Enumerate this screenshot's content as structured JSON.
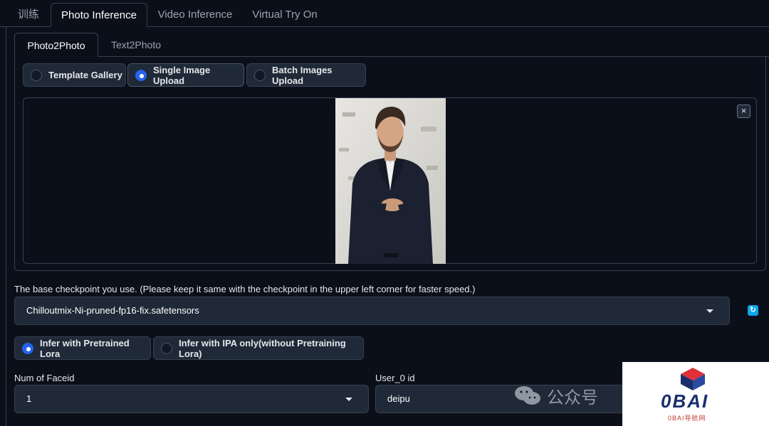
{
  "top_tabs": [
    "训练",
    "Photo Inference",
    "Video Inference",
    "Virtual Try On"
  ],
  "inner_tabs": [
    "Photo2Photo",
    "Text2Photo"
  ],
  "upload_mode": {
    "options": [
      "Template Gallery",
      "Single Image Upload",
      "Batch Images Upload"
    ],
    "selected": "Single Image Upload"
  },
  "image_panel": {
    "close_glyph": "×"
  },
  "checkpoint": {
    "label": "The base checkpoint you use. (Please keep it same with the checkpoint in the upper left corner for faster speed.)",
    "value": "Chilloutmix-Ni-pruned-fp16-fix.safetensors"
  },
  "infer_mode": {
    "options": [
      "Infer with Pretrained Lora",
      "Infer with IPA only(without Pretraining Lora)"
    ],
    "selected": "Infer with Pretrained Lora"
  },
  "num_faceid": {
    "label": "Num of Faceid",
    "value": "1"
  },
  "user_id": {
    "label": "User_0 id",
    "value": "deipu"
  },
  "watermark": {
    "text": "公众号",
    "logo": "0BAI",
    "logo_sub": "0BAI导航网"
  },
  "colors": {
    "accent": "#2563eb",
    "refresh": "#0ea5e9",
    "background": "#0b0f19"
  },
  "icons": [
    "close-icon",
    "refresh-icon",
    "chevron-down-icon",
    "wechat-icon",
    "cube-icon"
  ]
}
